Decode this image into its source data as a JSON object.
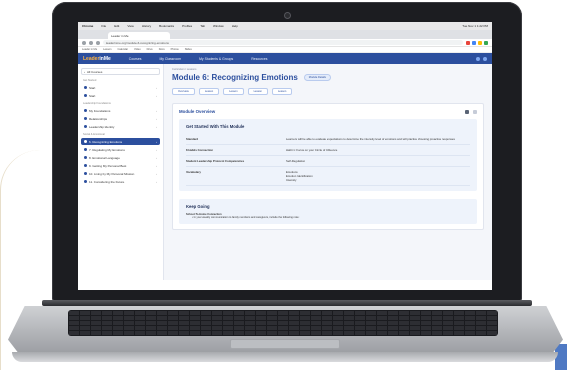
{
  "browser": {
    "menubar": [
      "Chrome",
      "File",
      "Edit",
      "View",
      "History",
      "Bookmarks",
      "Profiles",
      "Tab",
      "Window",
      "Help"
    ],
    "menubar_right": "Tue Nov 1 1:22 PM",
    "tab_title": "Leader in Me",
    "url": "leaderinme.org/module-6-recognizing-emotions",
    "bookmarks": [
      "Leader in Me",
      "Lesson",
      "Calendar",
      "Video",
      "Drive",
      "Docs",
      "Photos",
      "Slides"
    ]
  },
  "app": {
    "logo_a": "Leader",
    "logo_b": "inMe",
    "nav": [
      "Courses",
      "My Classroom",
      "My Students & Groups",
      "Resources"
    ]
  },
  "sidebar": {
    "all_label": "All Courses",
    "groups": [
      {
        "label": "Get Started",
        "items": [
          {
            "label": "Start",
            "active": false
          },
          {
            "label": "Start",
            "active": false
          }
        ]
      },
      {
        "label": "Leadership Foundations",
        "items": [
          {
            "label": "My Foundations",
            "active": false
          },
          {
            "label": "Relationships",
            "active": false
          },
          {
            "label": "Leadership Identity",
            "active": false
          }
        ]
      },
      {
        "label": "Social & Emotional",
        "items": [
          {
            "label": "6. Recognizing Emotions",
            "active": true
          },
          {
            "label": "7. Regulating My Emotions",
            "active": false
          },
          {
            "label": "8. Emotional Language",
            "active": false
          },
          {
            "label": "9. Getting My Personal Best",
            "active": false
          },
          {
            "label": "10. Living by My Personal Mission",
            "active": false
          },
          {
            "label": "11. Considering the Future",
            "active": false
          }
        ]
      }
    ]
  },
  "main": {
    "breadcrumb": "Curriculum / Lessons",
    "title": "Module 6: Recognizing Emotions",
    "pill": "Module Details",
    "tabs": [
      "Overview",
      "Lesson",
      "Lesson",
      "Lesson",
      "Lesson"
    ],
    "overview_heading": "Module Overview",
    "section_title": "Get Started With This Module",
    "rows": [
      {
        "k": "Standard",
        "v": "Learners will be able to evaluate expectations to determine the intensity level of emotions and will practice choosing proactive responses"
      },
      {
        "k": "8 Habits Connection",
        "v": "Habit 1: Focus on your Circle of Influence"
      },
      {
        "k": "Student Leadership Protocol Competencies",
        "v": "Self-Regulation"
      },
      {
        "k": "Vocabulary",
        "v": "Emotions\nEmotion Identification\nIntensity"
      }
    ],
    "keep_title": "Keep Going",
    "keep_bold": "School-To-Home Connection",
    "keep_text": "In your weekly communication to family members and caregivers, include the following note:"
  },
  "colors": {
    "brand": "#2c4f9e",
    "accent": "#ffb340"
  }
}
